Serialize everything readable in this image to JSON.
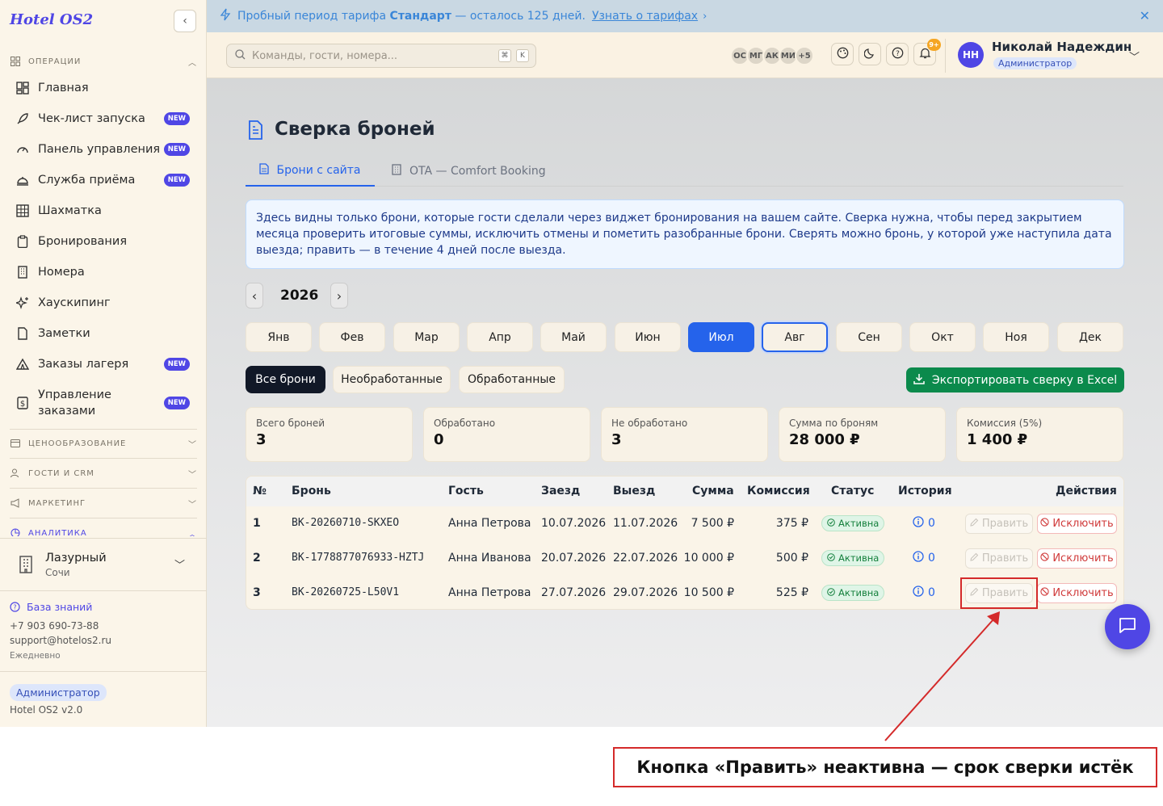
{
  "sidebar": {
    "brand": "Hotel OS2",
    "operations_label": "ОПЕРАЦИИ",
    "items": [
      {
        "label": "Главная",
        "new": false
      },
      {
        "label": "Чек-лист запуска",
        "new": true
      },
      {
        "label": "Панель управления",
        "new": true
      },
      {
        "label": "Служба приёма",
        "new": true
      },
      {
        "label": "Шахматка",
        "new": false
      },
      {
        "label": "Бронирования",
        "new": false
      },
      {
        "label": "Номера",
        "new": false
      },
      {
        "label": "Хаускипинг",
        "new": false
      },
      {
        "label": "Заметки",
        "new": false
      },
      {
        "label": "Заказы лагеря",
        "new": true
      },
      {
        "label": "Управление заказами",
        "new": true
      }
    ],
    "new_badge": "NEW",
    "pricing_label": "ЦЕНООБРАЗОВАНИЕ",
    "guests_label": "ГОСТИ И CRM",
    "marketing_label": "МАРКЕТИНГ",
    "analytics_label": "АНАЛИТИКА",
    "hotel_name": "Лазурный",
    "hotel_city": "Сочи",
    "kb_label": "База знаний",
    "phone": "+7 903 690-73-88",
    "email": "support@hotelos2.ru",
    "schedule": "Ежедневно",
    "role": "Администратор",
    "version": "Hotel OS2 v2.0"
  },
  "banner": {
    "text_before": "Пробный период тарифа",
    "plan": "Стандарт",
    "text_after": "— осталось 125 дней.",
    "link": "Узнать о тарифах"
  },
  "topbar": {
    "search_placeholder": "Команды, гости, номера...",
    "kbd1": "⌘",
    "kbd2": "K",
    "avatars": [
      "ОС",
      "МГ",
      "АК",
      "МИ",
      "+5"
    ],
    "notif_count": "9+",
    "user_initials": "НН",
    "user_name": "Николай Надеждин",
    "user_role": "Администратор"
  },
  "page": {
    "title": "Сверка броней",
    "tabs": [
      "Брони с сайта",
      "OTA — Comfort Booking"
    ],
    "info": "Здесь видны только брони, которые гости сделали через виджет бронирования на вашем сайте. Сверка нужна, чтобы перед закрытием месяца проверить итоговые суммы, исключить отмены и пометить разобранные брони. Сверять можно бронь, у которой уже наступила дата выезда; править — в течение 4 дней после выезда.",
    "year": "2026",
    "prev": "‹",
    "next": "›",
    "months": [
      "Янв",
      "Фев",
      "Мар",
      "Апр",
      "Май",
      "Июн",
      "Июл",
      "Авг",
      "Сен",
      "Окт",
      "Ноя",
      "Дек"
    ],
    "filters": [
      "Все брони",
      "Необработанные",
      "Обработанные"
    ],
    "export": "Экспортировать сверку в Excel",
    "stats": [
      {
        "label": "Всего броней",
        "value": "3"
      },
      {
        "label": "Обработано",
        "value": "0"
      },
      {
        "label": "Не обработано",
        "value": "3"
      },
      {
        "label": "Сумма по броням",
        "value": "28 000 ₽"
      },
      {
        "label": "Комиссия (5%)",
        "value": "1 400 ₽"
      }
    ],
    "columns": [
      "№",
      "Бронь",
      "Гость",
      "Заезд",
      "Выезд",
      "Сумма",
      "Комиссия",
      "Статус",
      "История",
      "Действия"
    ],
    "rows": [
      {
        "n": "1",
        "id": "BK-20260710-SKXEO",
        "guest": "Анна Петрова",
        "in": "10.07.2026",
        "out": "11.07.2026",
        "sum": "7 500 ₽",
        "fee": "375 ₽",
        "status": "Активна",
        "hist": "0"
      },
      {
        "n": "2",
        "id": "BK-1778877076933-HZTJ",
        "guest": "Анна Иванова",
        "in": "20.07.2026",
        "out": "22.07.2026",
        "sum": "10 000 ₽",
        "fee": "500 ₽",
        "status": "Активна",
        "hist": "0"
      },
      {
        "n": "3",
        "id": "BK-20260725-L50V1",
        "guest": "Анна Петрова",
        "in": "27.07.2026",
        "out": "29.07.2026",
        "sum": "10 500 ₽",
        "fee": "525 ₽",
        "status": "Активна",
        "hist": "0"
      }
    ],
    "edit_label": "Править",
    "exclude_label": "Исключить"
  },
  "annotation": {
    "text": "Кнопка «Править» неактивна — срок сверки истёк",
    "color": "#d42a2a"
  }
}
